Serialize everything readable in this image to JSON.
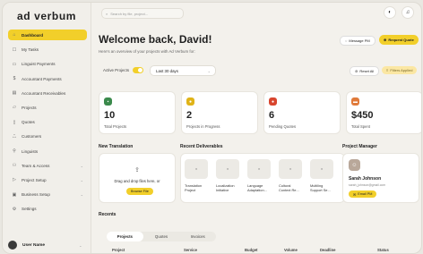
{
  "brand": "ad verbum",
  "search": {
    "placeholder": "Search by file, project..."
  },
  "sidebar": {
    "items": [
      {
        "label": "Dashboard"
      },
      {
        "label": "My Tasks"
      },
      {
        "label": "Linguist Payments"
      },
      {
        "label": "Accountant Payments"
      },
      {
        "label": "Accountant Receivables"
      },
      {
        "label": "Projects"
      },
      {
        "label": "Quotes"
      },
      {
        "label": "Customers"
      },
      {
        "label": "Linguists"
      },
      {
        "label": "Team & Access"
      },
      {
        "label": "Project Setup"
      },
      {
        "label": "Business Setup"
      },
      {
        "label": "Settings"
      }
    ],
    "user": "User Name"
  },
  "header": {
    "title": "Welcome back, David!",
    "subtitle": "Here's an overview of your projects with Ad Verbum for:",
    "message_pm": "Message PM",
    "request_quote": "Request Quote"
  },
  "filters": {
    "active_label": "Active Projects",
    "range": "Last 30 days",
    "reset": "Reset All",
    "applied": "Filters Applied"
  },
  "stats": [
    {
      "value": "10",
      "label": "Total Projects",
      "color": "#3b8a4c"
    },
    {
      "value": "2",
      "label": "Projects in Progress",
      "color": "#e0b317"
    },
    {
      "value": "6",
      "label": "Pending Quotes",
      "color": "#d8452e"
    },
    {
      "value": "$450",
      "label": "Total Spent",
      "color": "#e07a3a"
    }
  ],
  "new_translation": {
    "title": "New Translation",
    "drop_text": "Drag and drop files here, or",
    "browse": "Browse File"
  },
  "deliverables": {
    "title": "Recent Deliverables",
    "items": [
      {
        "line1": "Translation",
        "line2": "Project"
      },
      {
        "line1": "Localization",
        "line2": "Initiative"
      },
      {
        "line1": "Language",
        "line2": "Adaptation..."
      },
      {
        "line1": "Cultural",
        "line2": "Context Re..."
      },
      {
        "line1": "Multiling",
        "line2": "Support Se..."
      }
    ]
  },
  "project_manager": {
    "title": "Project Manager",
    "name": "Sarah Johnson",
    "email": "sarah_johnson@gmail.com",
    "email_btn": "Email PM"
  },
  "recents": {
    "title": "Recents",
    "tabs": [
      "Projects",
      "Quotes",
      "Invoices"
    ],
    "columns": [
      "Project",
      "Service",
      "Budget",
      "Volume",
      "Deadline",
      "Status"
    ]
  }
}
